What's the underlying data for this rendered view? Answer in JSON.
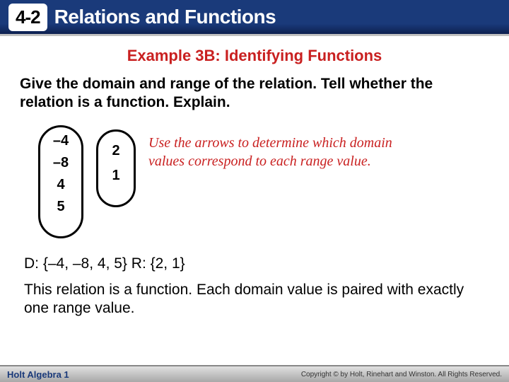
{
  "header": {
    "section_number": "4-2",
    "title": "Relations and Functions"
  },
  "example": {
    "title": "Example 3B: Identifying Functions",
    "prompt": "Give the domain and range of the relation. Tell whether the relation is a function. Explain."
  },
  "diagram": {
    "domain_values": [
      "–4",
      "–8",
      "4",
      "5"
    ],
    "range_values": [
      "2",
      "1"
    ],
    "hint": "Use the arrows to determine which domain values correspond to each range value."
  },
  "answer": {
    "domain_range": "D: {–4, –8, 4, 5} R: {2, 1}",
    "explanation": "This relation is a function. Each domain value is paired with exactly one range value."
  },
  "footer": {
    "left": "Holt Algebra 1",
    "right": "Copyright © by Holt, Rinehart and Winston. All Rights Reserved."
  }
}
